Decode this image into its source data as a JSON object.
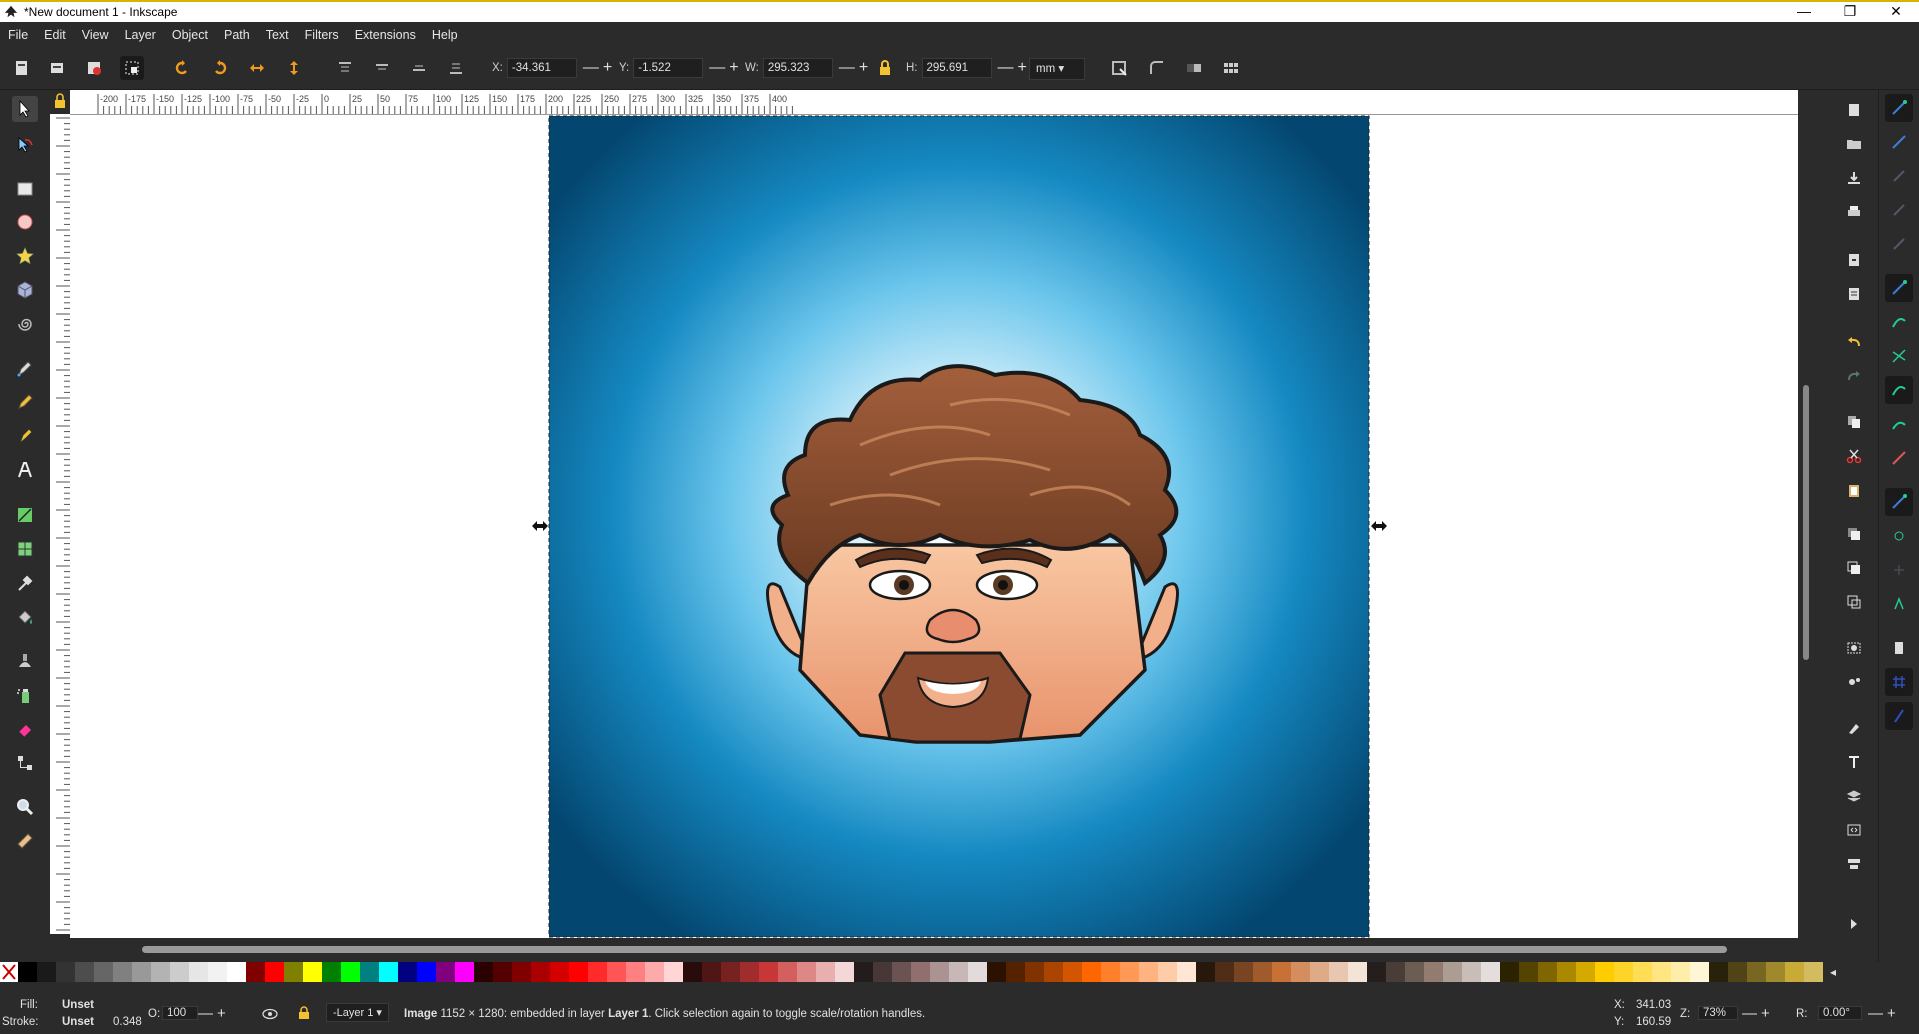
{
  "window": {
    "title": "*New document 1 - Inkscape",
    "min": "—",
    "max": "❐",
    "close": "✕"
  },
  "menu": [
    "File",
    "Edit",
    "View",
    "Layer",
    "Object",
    "Path",
    "Text",
    "Filters",
    "Extensions",
    "Help"
  ],
  "toolbar": {
    "x_label": "X:",
    "x_value": "-34.361",
    "y_label": "Y:",
    "y_value": "-1.522",
    "w_label": "W:",
    "w_value": "295.323",
    "h_label": "H:",
    "h_value": "295.691",
    "unit": "mm",
    "pm": "—+"
  },
  "ruler": {
    "labels": [
      "-200",
      "-175",
      "-150",
      "-125",
      "-100",
      "-75",
      "-50",
      "-25",
      "0",
      "25",
      "50",
      "75",
      "100",
      "125",
      "150",
      "175",
      "200",
      "225",
      "250",
      "275",
      "300",
      "325",
      "350",
      "375",
      "400"
    ]
  },
  "palette": [
    "#000000",
    "#1a1a1a",
    "#333333",
    "#4d4d4d",
    "#666666",
    "#808080",
    "#999999",
    "#b3b3b3",
    "#cccccc",
    "#e6e6e6",
    "#f2f2f2",
    "#ffffff",
    "#800000",
    "#ff0000",
    "#808000",
    "#ffff00",
    "#008000",
    "#00ff00",
    "#008080",
    "#00ffff",
    "#000080",
    "#0000ff",
    "#800080",
    "#ff00ff",
    "#2b0000",
    "#550000",
    "#800000",
    "#aa0000",
    "#d40000",
    "#ff0000",
    "#ff2a2a",
    "#ff5555",
    "#ff8080",
    "#ffaaaa",
    "#ffd5d5",
    "#280b0b",
    "#501616",
    "#782121",
    "#a02c2c",
    "#c83737",
    "#d35f5f",
    "#de8787",
    "#e9afaf",
    "#f4d7d7",
    "#241c1c",
    "#483737",
    "#6c5353",
    "#916f6f",
    "#ac9393",
    "#c8b7b7",
    "#e3dbdb",
    "#2b1100",
    "#552200",
    "#803300",
    "#aa4400",
    "#d45500",
    "#ff6600",
    "#ff7f2a",
    "#ff9955",
    "#ffb380",
    "#ffccaa",
    "#ffe6d5",
    "#28170b",
    "#502d16",
    "#784421",
    "#a05a2c",
    "#c87137",
    "#d38d5f",
    "#deaa87",
    "#e9c6af",
    "#f4e3d7",
    "#241f1c",
    "#483e37",
    "#6c5d53",
    "#917c6f",
    "#ac9d93",
    "#c8beb7",
    "#e3dedb",
    "#2b2200",
    "#554400",
    "#806600",
    "#aa8800",
    "#d4aa00",
    "#ffcc00",
    "#ffd42a",
    "#ffdd55",
    "#ffe680",
    "#ffeeaa",
    "#fff6d5",
    "#28220b",
    "#504416",
    "#786721",
    "#a0892c",
    "#c8ab37",
    "#d3bc5f"
  ],
  "status": {
    "fill_label": "Fill:",
    "fill_value": "Unset",
    "stroke_label": "Stroke:",
    "stroke_value": "Unset",
    "stroke_width": "0.348",
    "opacity_label": "O:",
    "opacity_value": "100",
    "layer": "-Layer 1",
    "message_bold": "Image",
    "message_1": " 1152 × 1280: embedded in layer ",
    "message_layer": "Layer 1",
    "message_2": ". Click selection again to toggle scale/rotation handles.",
    "x_label": "X:",
    "x_value": "341.03",
    "y_label": "Y:",
    "y_value": "160.59",
    "zoom_label": "Z:",
    "zoom_value": "73%",
    "rotate_label": "R:",
    "rotate_value": "0.00°"
  },
  "colors": {
    "accent": "#d4b500",
    "bg_dark": "#2b2b2b",
    "bg_gradient_center": "#bfe6f7",
    "bg_gradient_edge": "#06507e"
  }
}
